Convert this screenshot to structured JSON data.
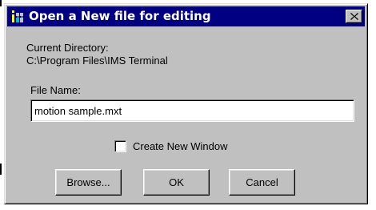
{
  "window": {
    "title": "Open a New file for editing",
    "title_bar_color": "#000080",
    "face_color": "#c0c0c0",
    "close_icon": "close-x-icon",
    "app_icon": "ims-terminal-app-icon"
  },
  "current_directory": {
    "label": "Current Directory:",
    "path": "C:\\Program Files\\IMS Terminal"
  },
  "file_name": {
    "label": "File Name:",
    "value": "motion sample.mxt"
  },
  "create_new_window": {
    "label": "Create New Window",
    "checked": false
  },
  "buttons": {
    "browse": "Browse...",
    "ok": "OK",
    "cancel": "Cancel"
  }
}
